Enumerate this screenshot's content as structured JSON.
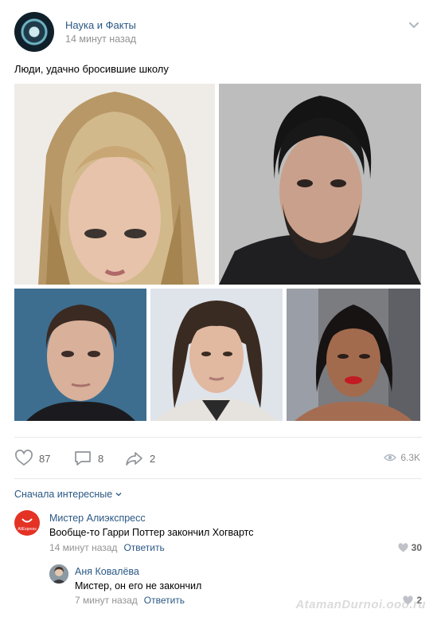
{
  "post": {
    "group_name": "Наука и Факты",
    "time": "14 минут назад",
    "text": "Люди, удачно бросившие школу"
  },
  "actions": {
    "likes": "87",
    "comments": "8",
    "shares": "2",
    "views": "6.3K"
  },
  "comments_sort": "Сначала интересные",
  "comments": [
    {
      "author": "Мистер Алиэкспресс",
      "avatar_text": "AliExpress",
      "text": "Вообще-то Гарри Поттер закончил Хогвартс",
      "time": "14 минут назад",
      "reply": "Ответить",
      "likes": "30"
    },
    {
      "author": "Аня Ковалёва",
      "text": "Мистер, он его не закончил",
      "time": "7 минут назад",
      "reply": "Ответить",
      "likes": "2"
    }
  ],
  "watermark": "AtamanDurnoi.ooo.ru",
  "icons": {
    "like": "heart-icon",
    "comment": "comment-icon",
    "share": "share-icon",
    "views": "eye-icon",
    "menu": "chevron-down-icon"
  },
  "colors": {
    "link": "#2a5885",
    "secondary": "#939393",
    "aliexpress": "#e43225"
  }
}
